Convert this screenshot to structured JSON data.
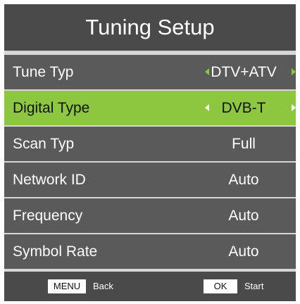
{
  "title": "Tuning Setup",
  "menu": [
    {
      "label": "Tune Typ",
      "value": "DTV+ATV",
      "selected": false,
      "arrows": true
    },
    {
      "label": "Digital Type",
      "value": "DVB-T",
      "selected": true,
      "arrows": true
    },
    {
      "label": "Scan Typ",
      "value": "Full",
      "selected": false,
      "arrows": false
    },
    {
      "label": "Network ID",
      "value": "Auto",
      "selected": false,
      "arrows": false
    },
    {
      "label": "Frequency",
      "value": "Auto",
      "selected": false,
      "arrows": false
    },
    {
      "label": "Symbol Rate",
      "value": "Auto",
      "selected": false,
      "arrows": false
    }
  ],
  "footer": {
    "menu_key": "MENU",
    "menu_action": "Back",
    "ok_key": "OK",
    "ok_action": "Start"
  },
  "colors": {
    "highlight": "#8dc63f",
    "row_bg": "#5a5a5a",
    "title_bg": "#4a4a4a"
  },
  "icons": [
    "arrow-left-icon",
    "arrow-right-icon"
  ]
}
